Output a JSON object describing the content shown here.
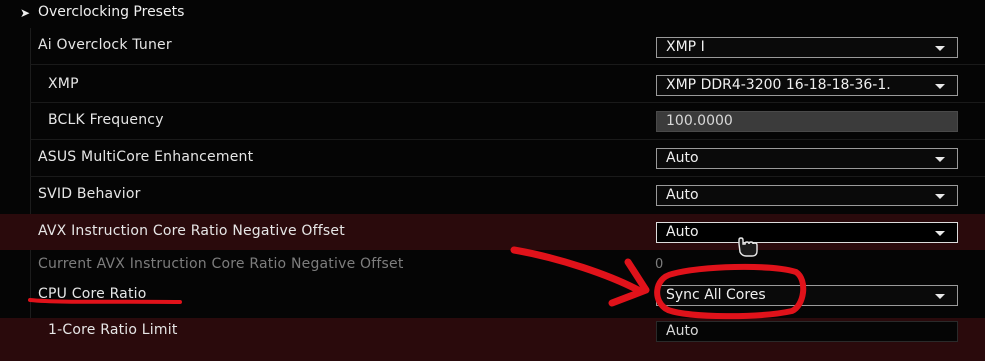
{
  "section": {
    "arrow_glyph": "➤",
    "title": "Overclocking Presets"
  },
  "settings": [
    {
      "label": "Ai Overclock Tuner",
      "value": "XMP I"
    },
    {
      "label": "XMP",
      "value": "XMP DDR4-3200 16-18-18-36-1."
    },
    {
      "label": "BCLK Frequency",
      "value": "100.0000"
    },
    {
      "label": "ASUS MultiCore Enhancement",
      "value": "Auto"
    },
    {
      "label": "SVID Behavior",
      "value": "Auto"
    },
    {
      "label": "AVX Instruction Core Ratio Negative Offset",
      "value": "Auto"
    },
    {
      "label": "Current AVX Instruction Core Ratio Negative Offset",
      "value": "0"
    },
    {
      "label": "CPU Core Ratio",
      "value": "Sync All Cores"
    },
    {
      "label": "1-Core Ratio Limit",
      "value": "Auto"
    }
  ],
  "colors": {
    "annotation_red": "#e0121a",
    "highlight_row": "#2a0a0c"
  },
  "icons": {
    "cursor": "hand-pointer-icon",
    "section_arrow": "arrow-right-icon"
  }
}
